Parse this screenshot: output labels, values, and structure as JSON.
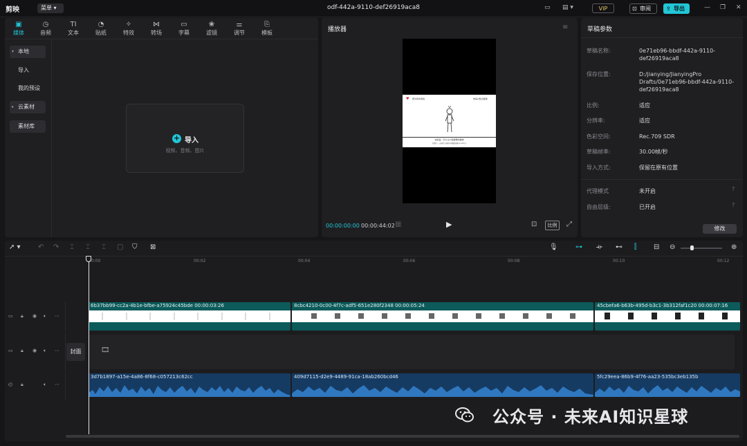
{
  "app": {
    "logo": "剪映",
    "menu_label": "菜单",
    "project_title": "odf-442a-9110-def26919aca8",
    "vip": "VIP",
    "review_label": "审阅",
    "export_label": "导出"
  },
  "media": {
    "tabs": [
      {
        "label": "媒体",
        "icon": "play-square-icon"
      },
      {
        "label": "音频",
        "icon": "music-note-icon"
      },
      {
        "label": "文本",
        "icon": "text-icon"
      },
      {
        "label": "贴纸",
        "icon": "sticker-icon"
      },
      {
        "label": "特效",
        "icon": "sparkle-icon"
      },
      {
        "label": "转场",
        "icon": "transition-icon"
      },
      {
        "label": "字幕",
        "icon": "caption-icon"
      },
      {
        "label": "滤镜",
        "icon": "filter-icon"
      },
      {
        "label": "调节",
        "icon": "adjust-icon"
      },
      {
        "label": "模板",
        "icon": "template-icon"
      }
    ],
    "sidebar": [
      "本地",
      "导入",
      "我的预设",
      "云素材",
      "素材库"
    ],
    "import_label": "导入",
    "import_hint": "视频、音频、图片"
  },
  "player": {
    "title": "播放器",
    "current_time": "00:00:00:00",
    "total_time": "00:00:44:02",
    "ratio_label": "比例",
    "frame_left": "因为有中间线",
    "frame_right": "未来AI知识星球",
    "frame_caption": "这就是，怎么让AI来解释的事物",
    "frame_caption2": "新用户，来创作大家的AI视频创意(ai-story)"
  },
  "draft": {
    "title": "草稿参数",
    "rows": [
      {
        "label": "草稿名称:",
        "value": "0e71eb96-bbdf-442a-9110-def26919aca8"
      },
      {
        "label": "保存位置:",
        "value": "D:/jianying/JianyingPro Drafts/0e71eb96-bbdf-442a-9110-def26919aca8"
      },
      {
        "label": "比例:",
        "value": "适应"
      },
      {
        "label": "分辨率:",
        "value": "适应"
      },
      {
        "label": "色彩空间:",
        "value": "Rec.709 SDR"
      },
      {
        "label": "草稿帧率:",
        "value": "30.00帧/秒"
      },
      {
        "label": "导入方式:",
        "value": "保留在原有位置"
      },
      {
        "label": "代理模式",
        "value": "未开启"
      },
      {
        "label": "自由层级:",
        "value": "已开启"
      }
    ],
    "modify_label": "修改"
  },
  "timeline": {
    "ticks": [
      "00:00",
      "00:02",
      "00:04",
      "00:06",
      "00:08",
      "00:10",
      "00:12"
    ],
    "cover_label": "封面",
    "video_clips": [
      {
        "name": "6b37bb99-cc2a-4b1e-bfbe-a75924c45bde",
        "duration": "00:00:03:26"
      },
      {
        "name": "8cbc4210-0c00-4f7c-adf5-651e280f2348",
        "duration": "00:00:05:24"
      },
      {
        "name": "45cbefa6-b63b-495d-b3c1-3b312faf1c20",
        "duration": "00:00:07:16"
      }
    ],
    "audio_clips": [
      {
        "name": "3d7b1897-a15e-4a86-8f68-c057213c62cc"
      },
      {
        "name": "409d7115-d2e9-4489-91ca-18ab260bcd46"
      },
      {
        "name": "5fc29eea-86b9-4f76-aa23-535bc3eb135b"
      }
    ]
  },
  "watermark": "公众号 · 未来AI知识星球",
  "colors": {
    "accent": "#22c6d6",
    "video_clip": "#0c5a5a",
    "audio_clip": "#163b63"
  }
}
